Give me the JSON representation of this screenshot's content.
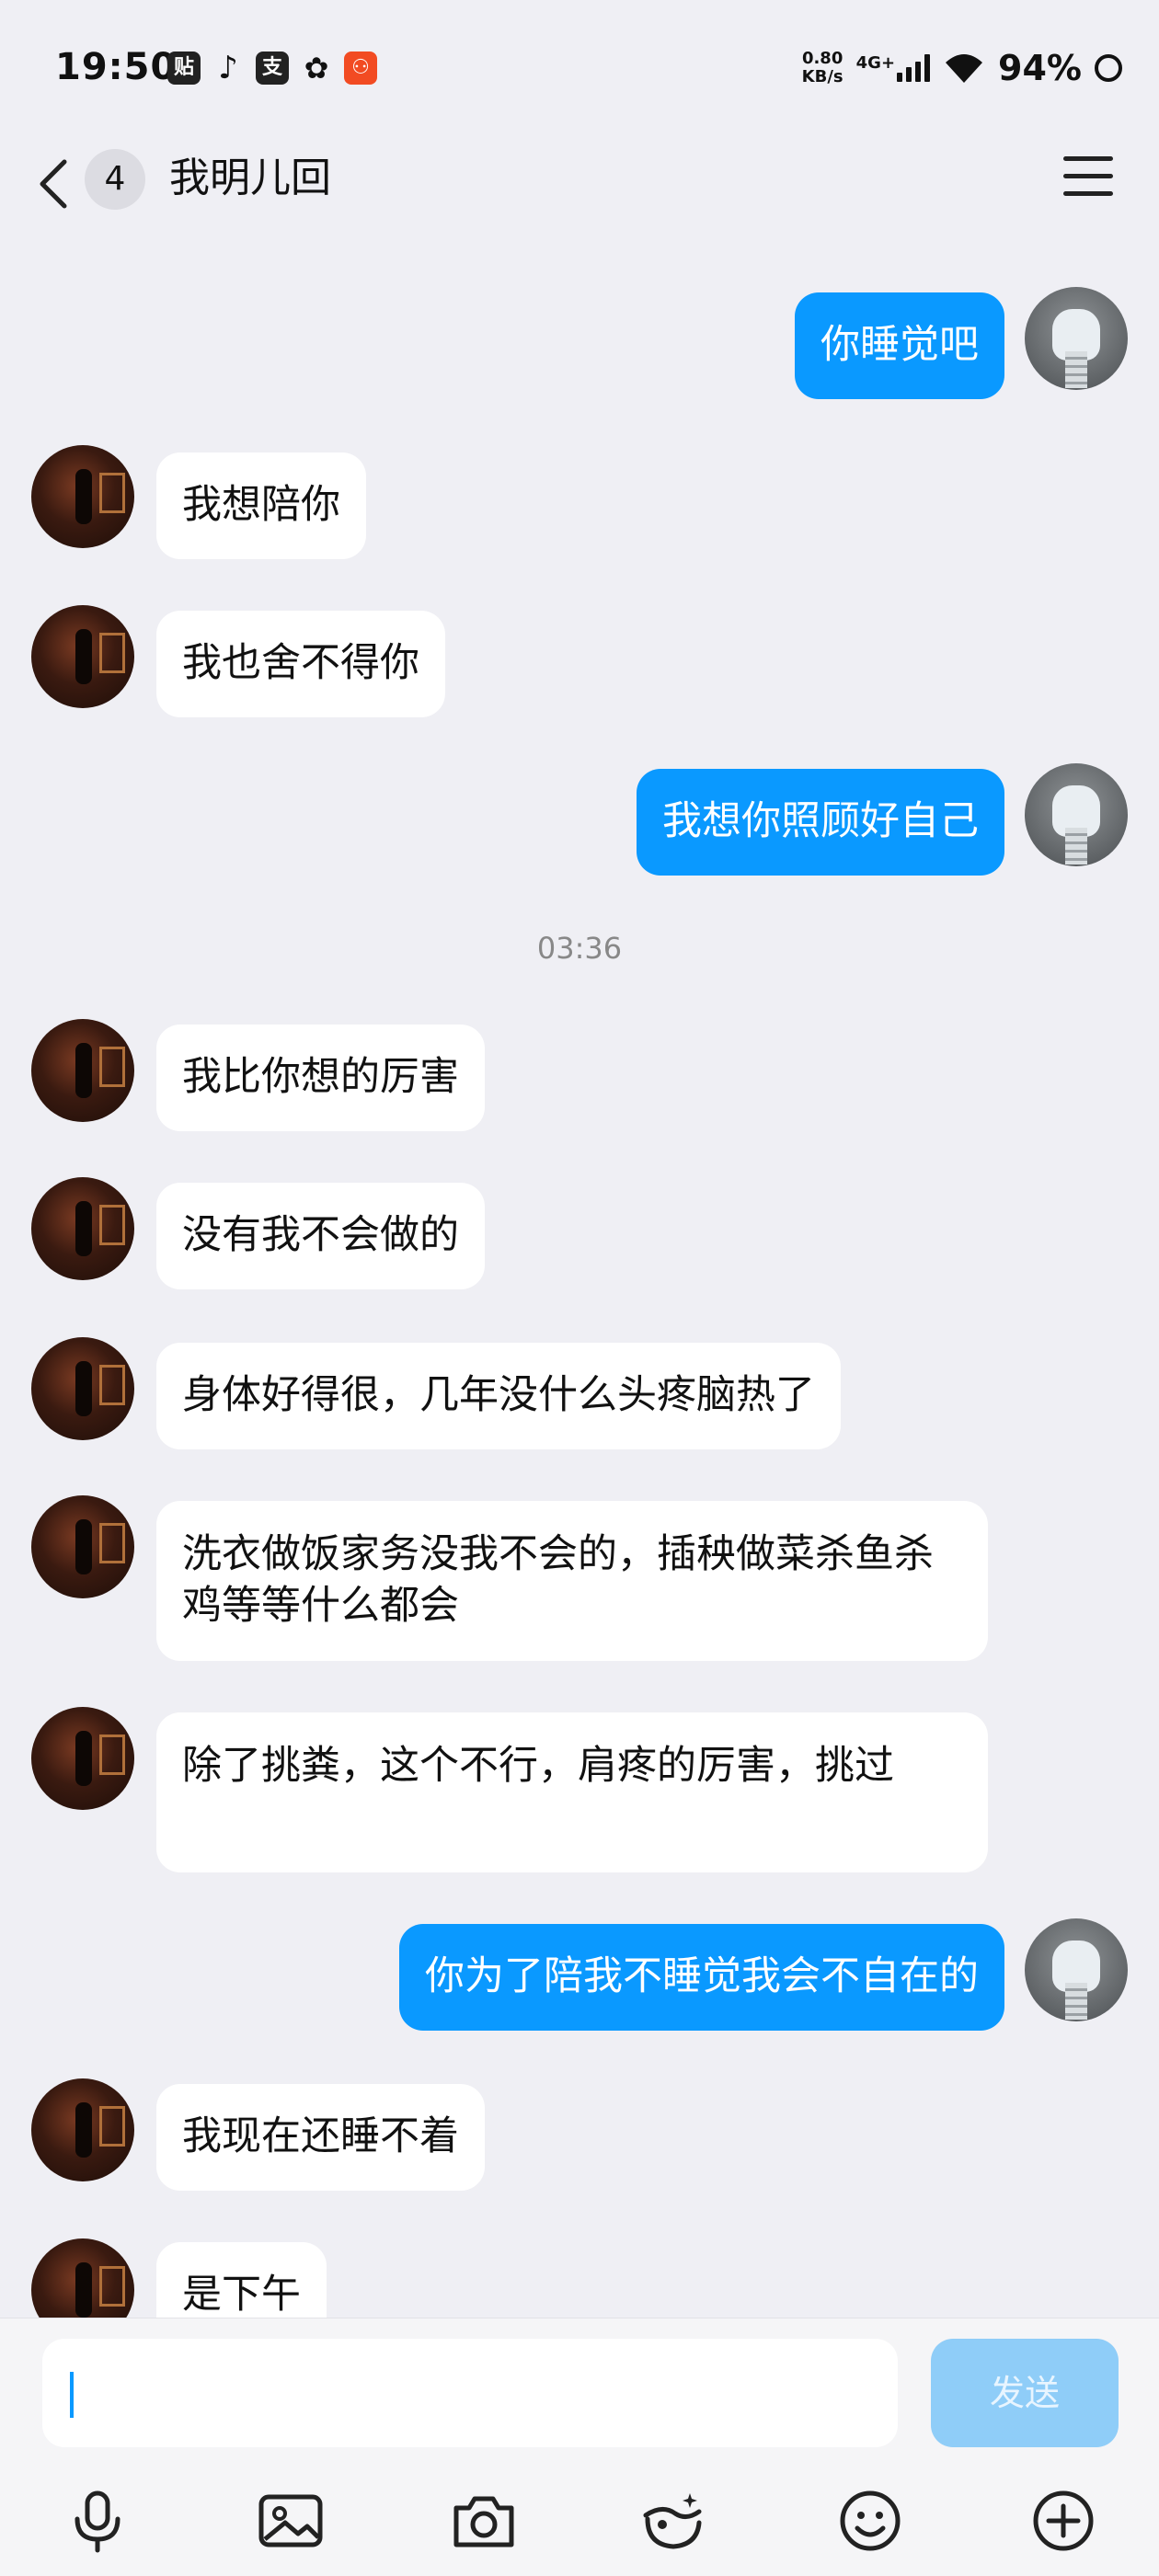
{
  "status_bar": {
    "time": "19:50",
    "notification_icons": [
      "贴",
      "♪",
      "支",
      "✿",
      "⚇"
    ],
    "net_speed_value": "0.80",
    "net_speed_unit": "KB/s",
    "signal": "4G+",
    "battery": "94%"
  },
  "header": {
    "unread_count": "4",
    "title": "我明儿回"
  },
  "chat": {
    "timestamp": "03:36",
    "messages": [
      {
        "from": "self",
        "text": "你睡觉吧"
      },
      {
        "from": "other",
        "text": "我想陪你"
      },
      {
        "from": "other",
        "text": "我也舍不得你"
      },
      {
        "from": "self",
        "text": "我想你照顾好自己"
      },
      {
        "from": "other",
        "text": "我比你想的厉害"
      },
      {
        "from": "other",
        "text": "没有我不会做的"
      },
      {
        "from": "other",
        "text": "身体好得很，几年没什么头疼脑热了"
      },
      {
        "from": "other",
        "text": "洗衣做饭家务没我不会的，插秧做菜杀鱼杀鸡等等什么都会"
      },
      {
        "from": "other",
        "text": "除了挑粪，这个不行，肩疼的厉害，挑过"
      },
      {
        "from": "self",
        "text": "你为了陪我不睡觉我会不自在的"
      },
      {
        "from": "other",
        "text": "我现在还睡不着"
      },
      {
        "from": "other",
        "text": "是下午"
      }
    ]
  },
  "composer": {
    "send_label": "发送"
  },
  "toolbar": {
    "icons": [
      "microphone-icon",
      "image-icon",
      "camera-icon",
      "face-effect-icon",
      "emoji-icon",
      "plus-icon"
    ]
  },
  "colors": {
    "outgoing_bubble": "#0a99ff",
    "incoming_bubble": "#ffffff",
    "background": "#efeff4",
    "send_disabled": "#8fcdf8"
  }
}
